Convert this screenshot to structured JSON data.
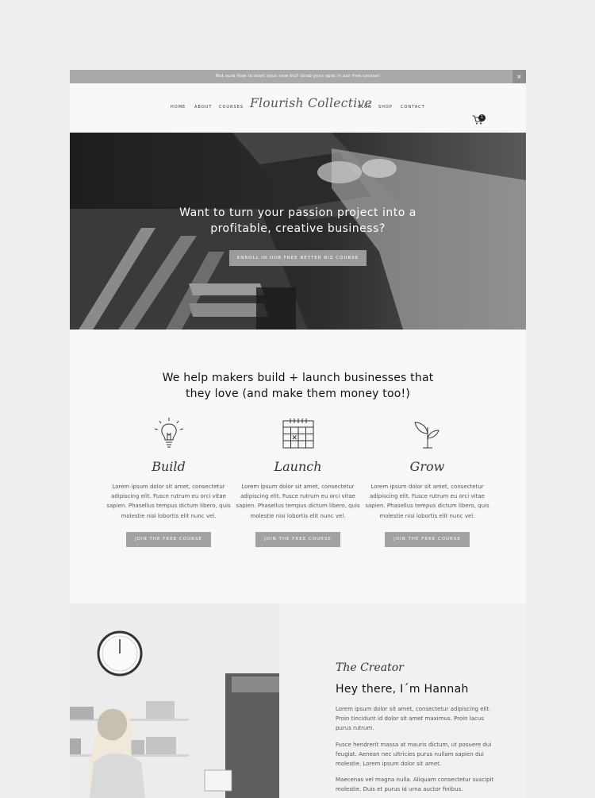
{
  "announcement": {
    "text": "Not sure how to start your new biz? Grab your spot in our free course!",
    "close": "×"
  },
  "nav": {
    "left_items": [
      "HOME",
      "ABOUT",
      "COURSES"
    ],
    "logo": "Flourish Collective",
    "right_items": [
      "BLOG",
      "SHOP",
      "CONTACT"
    ],
    "cart_count": "1"
  },
  "hero": {
    "headline_line1": "Want to turn your passion project into a",
    "headline_line2": "profitable, creative business?",
    "cta": "ENROLL IN OUR FREE BETTER BIZ COURSE"
  },
  "features": {
    "title_line1": "We help makers build + launch businesses that",
    "title_line2": "they love (and make them money too!)",
    "columns": [
      {
        "icon": "lightbulb-icon",
        "name": "Build",
        "desc": "Lorem ipsum dolor sit amet, consectetur adipiscing elit. Fusce rutrum eu orci vitae sapien. Phasellus tempus dictum libero, quis molestie nisi lobortis elit nunc vel.",
        "button": "JOIN THE FREE COURSE"
      },
      {
        "icon": "calendar-icon",
        "name": "Launch",
        "desc": "Lorem ipsum dolor sit amet, consectetur adipiscing elit. Fusce rutrum eu orci vitae sapien. Phasellus tempus dictum libero, quis molestie nisi lobortis elit nunc vel.",
        "button": "JOIN THE FREE COURSE"
      },
      {
        "icon": "sprout-icon",
        "name": "Grow",
        "desc": "Lorem ipsum dolor sit amet, consectetur adipiscing elit. Fusce rutrum eu orci vitae sapien. Phasellus tempus dictum libero, quis molestie nisi lobortis elit nunc vel.",
        "button": "JOIN THE FREE COURSE"
      }
    ]
  },
  "creator": {
    "tag": "The Creator",
    "heading": "Hey there, I´m Hannah",
    "p1": "Lorem ipsum dolor sit amet, consectetur adipiscing elit. Proin tincidunt id dolor sit amet maximus. Proin lacus purus rutrum.",
    "p2": "Fusce hendrerit massa at mauris dictum, ut posuere dui feugiat. Aenean nec ultricies purus nullam sapien dui molestie. Lorem ipsum dolor sit amet.",
    "p3": "Maecenas vel magna nulla. Aliquam consectetur suscipit molestie. Duis et purus id urna auctor finibus."
  }
}
